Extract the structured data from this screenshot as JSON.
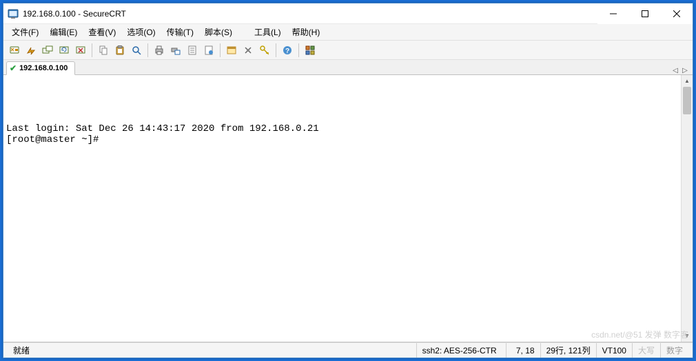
{
  "window": {
    "title": "192.168.0.100 - SecureCRT"
  },
  "menu": {
    "items": [
      "文件(F)",
      "编辑(E)",
      "查看(V)",
      "选项(O)",
      "传输(T)",
      "脚本(S)",
      "工具(L)",
      "帮助(H)"
    ]
  },
  "tab": {
    "label": "192.168.0.100"
  },
  "terminal": {
    "line1": "Last login: Sat Dec 26 14:43:17 2020 from 192.168.0.21",
    "line2": "[root@master ~]#"
  },
  "status": {
    "ready": "就绪",
    "cipher": "ssh2: AES-256-CTR",
    "cursor": "7,  18",
    "size": "29行, 121列",
    "term": "VT100",
    "caps": "大写",
    "num": "数字"
  },
  "watermark": "csdn.net/@51 发弹 数字客"
}
